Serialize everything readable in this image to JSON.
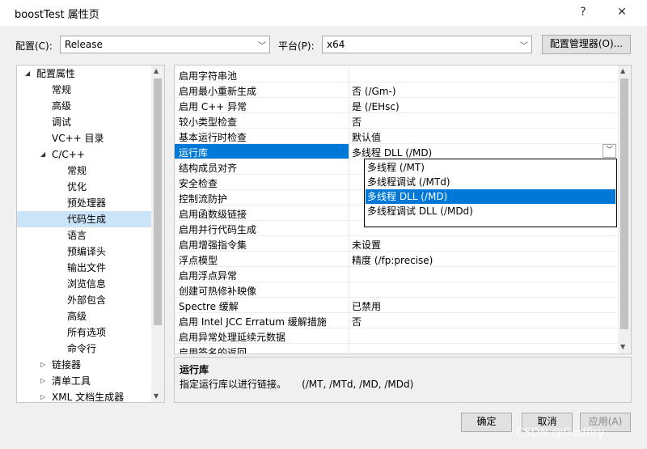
{
  "window": {
    "title": "boostTest 属性页",
    "help_glyph": "?",
    "close_glyph": "✕"
  },
  "toolbar": {
    "config_label": "配置(C):",
    "config_value": "Release",
    "platform_label": "平台(P):",
    "platform_value": "x64",
    "config_manager_label": "配置管理器(O)..."
  },
  "tree": {
    "items": [
      {
        "label": "配置属性",
        "expander": "◢"
      },
      {
        "label": "常规"
      },
      {
        "label": "高级"
      },
      {
        "label": "调试"
      },
      {
        "label": "VC++ 目录"
      },
      {
        "label": "C/C++",
        "expander": "◢"
      },
      {
        "label": "常规"
      },
      {
        "label": "优化"
      },
      {
        "label": "预处理器"
      },
      {
        "label": "代码生成",
        "selected": true
      },
      {
        "label": "语言"
      },
      {
        "label": "预编译头"
      },
      {
        "label": "输出文件"
      },
      {
        "label": "浏览信息"
      },
      {
        "label": "外部包含"
      },
      {
        "label": "高级"
      },
      {
        "label": "所有选项"
      },
      {
        "label": "命令行"
      },
      {
        "label": "链接器",
        "expander": "▷"
      },
      {
        "label": "清单工具",
        "expander": "▷"
      },
      {
        "label": "XML 文档生成器",
        "expander": "▷"
      }
    ]
  },
  "properties": {
    "rows": [
      {
        "name": "启用字符串池",
        "value": ""
      },
      {
        "name": "启用最小重新生成",
        "value": "否 (/Gm-)"
      },
      {
        "name": "启用 C++ 异常",
        "value": "是 (/EHsc)"
      },
      {
        "name": "较小类型检查",
        "value": "否"
      },
      {
        "name": "基本运行时检查",
        "value": "默认值"
      },
      {
        "name": "运行库",
        "value": "多线程 DLL (/MD)",
        "selected": true
      },
      {
        "name": "结构成员对齐",
        "value": ""
      },
      {
        "name": "安全检查",
        "value": ""
      },
      {
        "name": "控制流防护",
        "value": ""
      },
      {
        "name": "启用函数级链接",
        "value": ""
      },
      {
        "name": "启用并行代码生成",
        "value": ""
      },
      {
        "name": "启用增强指令集",
        "value": "未设置"
      },
      {
        "name": "浮点模型",
        "value": "精度 (/fp:precise)"
      },
      {
        "name": "启用浮点异常",
        "value": ""
      },
      {
        "name": "创建可热修补映像",
        "value": ""
      },
      {
        "name": "Spectre 缓解",
        "value": "已禁用"
      },
      {
        "name": "启用 Intel JCC Erratum 缓解措施",
        "value": "否"
      },
      {
        "name": "启用异常处理延续元数据",
        "value": ""
      },
      {
        "name": "启用签名的返回",
        "value": ""
      }
    ]
  },
  "dropdown": {
    "options": [
      {
        "label": "多线程 (/MT)"
      },
      {
        "label": "多线程调试 (/MTd)"
      },
      {
        "label": "多线程 DLL (/MD)",
        "selected": true
      },
      {
        "label": "多线程调试 DLL (/MDd)"
      }
    ]
  },
  "description": {
    "title": "运行库",
    "text": "指定运行库以进行链接。     (/MT, /MTd, /MD, /MDd)"
  },
  "buttons": {
    "ok": "确定",
    "cancel": "取消",
    "apply": "应用(A)"
  },
  "watermark": "CSDN @Godfiry"
}
